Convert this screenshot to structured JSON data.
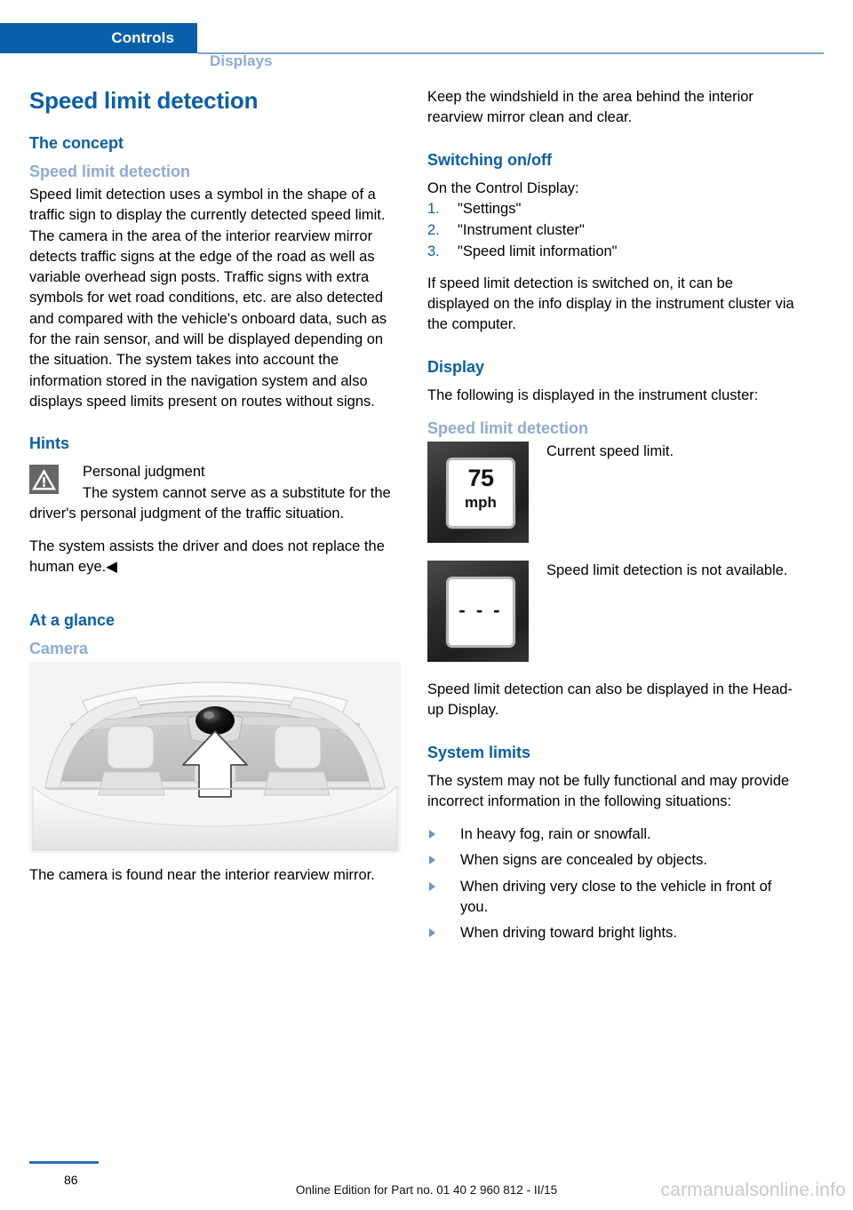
{
  "header": {
    "active_tab": "Controls",
    "inactive_tab": "Displays",
    "accent_color": "#0A5FA9",
    "muted_accent_color": "#8FAAD4"
  },
  "left_column": {
    "title": "Speed limit detection",
    "concept_heading": "The concept",
    "concept_sub": "Speed limit detection",
    "concept_body": "Speed limit detection uses a symbol in the shape of a traffic sign to display the currently detected speed limit. The camera in the area of the interior rearview mirror detects traffic signs at the edge of the road as well as variable overhead sign posts. Traffic signs with extra symbols for wet road conditions, etc. are also detected and compared with the vehicle's onboard data, such as for the rain sensor, and will be displayed depending on the situation. The system takes into account the information stored in the navigation system and also displays speed limits present on routes without signs.",
    "hints_heading": "Hints",
    "hint_title": "Personal judgment",
    "hint_body": "The system cannot serve as a substitute for the driver's personal judgment of the traffic situation.",
    "hint_closing": "The system assists the driver and does not replace the human eye.◀",
    "at_a_glance_heading": "At a glance",
    "camera_sub": "Camera",
    "camera_caption": "The camera is found near the interior rearview mirror.",
    "figure_alt": "camera-windshield-illustration"
  },
  "right_column": {
    "windshield_note": "Keep the windshield in the area behind the interior rearview mirror clean and clear.",
    "switching_heading": "Switching on/off",
    "switching_intro": "On the Control Display:",
    "steps": [
      {
        "number": "1.",
        "label": "\"Settings\""
      },
      {
        "number": "2.",
        "label": "\"Instrument cluster\""
      },
      {
        "number": "3.",
        "label": "\"Speed limit information\""
      }
    ],
    "switching_body": "If speed limit detection is switched on, it can be displayed on the info display in the instrument cluster via the computer.",
    "display_heading": "Display",
    "display_intro": "The following is displayed in the instrument cluster:",
    "display_sub": "Speed limit detection",
    "display_icons": [
      {
        "icon_name": "speed-limit-sign-75-mph",
        "sign_number": "75",
        "sign_unit": "mph",
        "caption": "Current speed limit."
      },
      {
        "icon_name": "speed-limit-sign-unavailable",
        "sign_dashes": "- - -",
        "caption": "Speed limit detection is not available."
      }
    ],
    "hud_note": "Speed limit detection can also be displayed in the Head-up Display.",
    "system_limits_heading": "System limits",
    "system_limits_intro": "The system may not be fully functional and may provide incorrect information in the following situations:",
    "system_limits_items": [
      "In heavy fog, rain or snowfall.",
      "When signs are concealed by objects.",
      "When driving very close to the vehicle in front of you.",
      "When driving toward bright lights."
    ]
  },
  "footer": {
    "page_number": "86",
    "edition_text": "Online Edition for Part no. 01 40 2 960 812 - II/15",
    "watermark": "carmanualsonline.info"
  }
}
